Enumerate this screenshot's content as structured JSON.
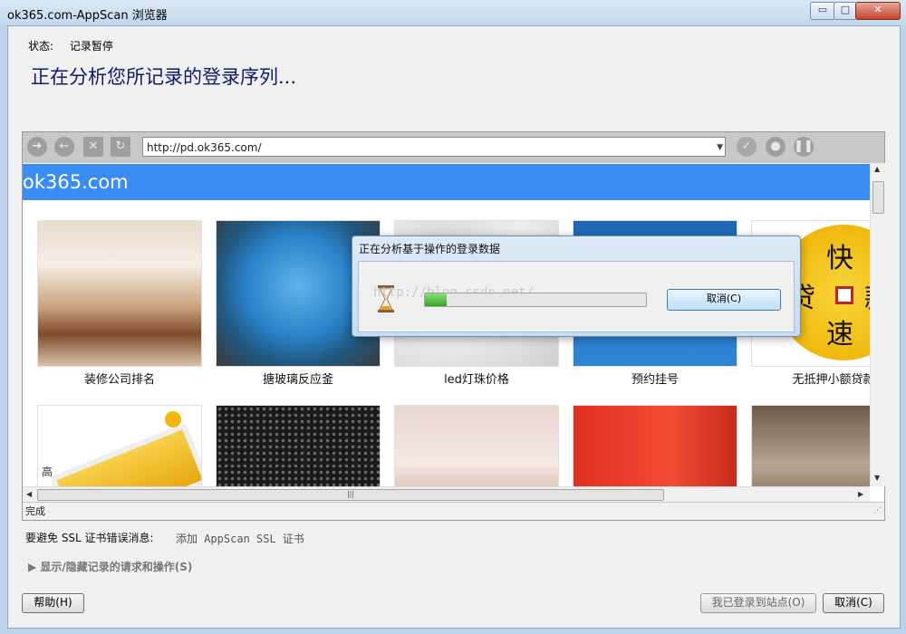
{
  "window": {
    "title": "ok365.com-AppScan 浏览器",
    "controls": {
      "minimize": "▭",
      "maximize": "□",
      "close": "✕"
    }
  },
  "status": {
    "label": "状态:",
    "value": "记录暂停"
  },
  "heading": "正在分析您所记录的登录序列...",
  "browser": {
    "address": "http://pd.ok365.com/",
    "site_title": "ok365.com",
    "statusbar": "完成",
    "tiles": [
      {
        "caption": "装修公司排名",
        "art": "room"
      },
      {
        "caption": "搪玻璃反应釜",
        "art": "tank"
      },
      {
        "caption": "led灯珠价格",
        "art": "led"
      },
      {
        "caption": "预约挂号",
        "art": "blue"
      },
      {
        "caption": "无抵押小额贷款",
        "art": "coin"
      },
      {
        "caption": "",
        "art": "chip"
      },
      {
        "caption": "",
        "art": "mesh"
      },
      {
        "caption": "",
        "art": "room2"
      },
      {
        "caption": "",
        "art": "gauge"
      },
      {
        "caption": "",
        "art": "room3"
      }
    ],
    "coin_text": {
      "top": "快",
      "left": "贷",
      "right": "款",
      "bottom": "速"
    },
    "chip_text": "高",
    "dialog": {
      "title": "正在分析基于操作的登录数据",
      "progress": 0.1,
      "watermark": "http://blog.csdn.net/",
      "cancel": "取消(C)"
    }
  },
  "ssl": {
    "label": "要避免 SSL 证书错误消息:",
    "link": "添加 AppScan SSL 证书"
  },
  "toggle": "▶ 显示/隐藏记录的请求和操作(S)",
  "footer": {
    "help": "帮助(H)",
    "logged_in": "我已登录到站点(O)",
    "cancel": "取消(C)"
  },
  "colors": {
    "site_header": "#3b8cf5",
    "heading": "#0e1a6e",
    "progress": "#2fa61f"
  }
}
